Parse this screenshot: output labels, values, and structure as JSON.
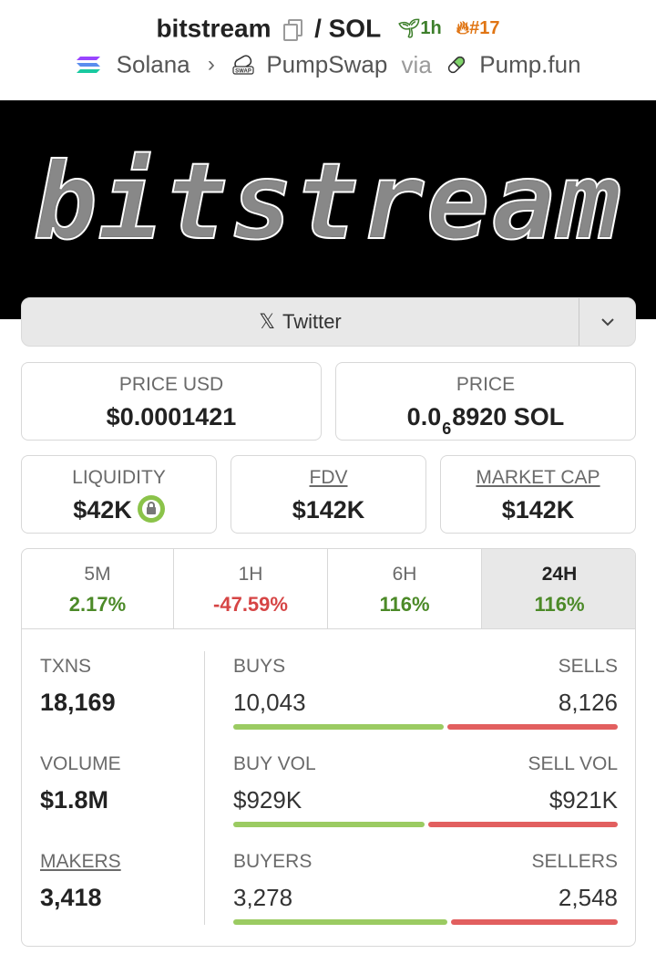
{
  "header": {
    "token_name": "bitstream",
    "separator": "/",
    "quote": "SOL",
    "age": "1h",
    "rank": "#17",
    "chain": "Solana",
    "dex": "PumpSwap",
    "via": "via",
    "launchpad": "Pump.fun",
    "dex_badge": "SWAP"
  },
  "banner": {
    "text": "bitstream"
  },
  "social": {
    "label": "Twitter",
    "x_glyph": "𝕏"
  },
  "price": {
    "usd_label": "PRICE USD",
    "usd_value": "$0.0001421",
    "native_label": "PRICE",
    "native_prefix": "0.0",
    "native_zeros": "6",
    "native_suffix": "8920 SOL"
  },
  "metrics": [
    {
      "label": "LIQUIDITY",
      "value": "$42K"
    },
    {
      "label": "FDV",
      "value": "$142K"
    },
    {
      "label": "MARKET CAP",
      "value": "$142K"
    }
  ],
  "timeframes": [
    {
      "label": "5M",
      "change": "2.17%"
    },
    {
      "label": "1H",
      "change": "-47.59%"
    },
    {
      "label": "6H",
      "change": "116%"
    },
    {
      "label": "24H",
      "change": "116%"
    }
  ],
  "stats": {
    "txns_label": "TXNS",
    "txns_value": "18,169",
    "volume_label": "VOLUME",
    "volume_value": "$1.8M",
    "makers_label": "MAKERS",
    "makers_value": "3,418",
    "buys_label": "BUYS",
    "buys_value": "10,043",
    "sells_label": "SELLS",
    "sells_value": "8,126",
    "buys_ratio": 0.553,
    "buy_vol_label": "BUY VOL",
    "buy_vol_value": "$929K",
    "sell_vol_label": "SELL VOL",
    "sell_vol_value": "$921K",
    "buy_vol_ratio": 0.502,
    "buyers_label": "BUYERS",
    "buyers_value": "3,278",
    "sellers_label": "SELLERS",
    "sellers_value": "2,548",
    "buyers_ratio": 0.563
  },
  "colors": {
    "positive": "#4c8a28",
    "negative": "#d64545",
    "buy_bar": "#9bcb62",
    "sell_bar": "#e25f5f",
    "age": "#3d7f2b",
    "rank": "#e07514"
  }
}
